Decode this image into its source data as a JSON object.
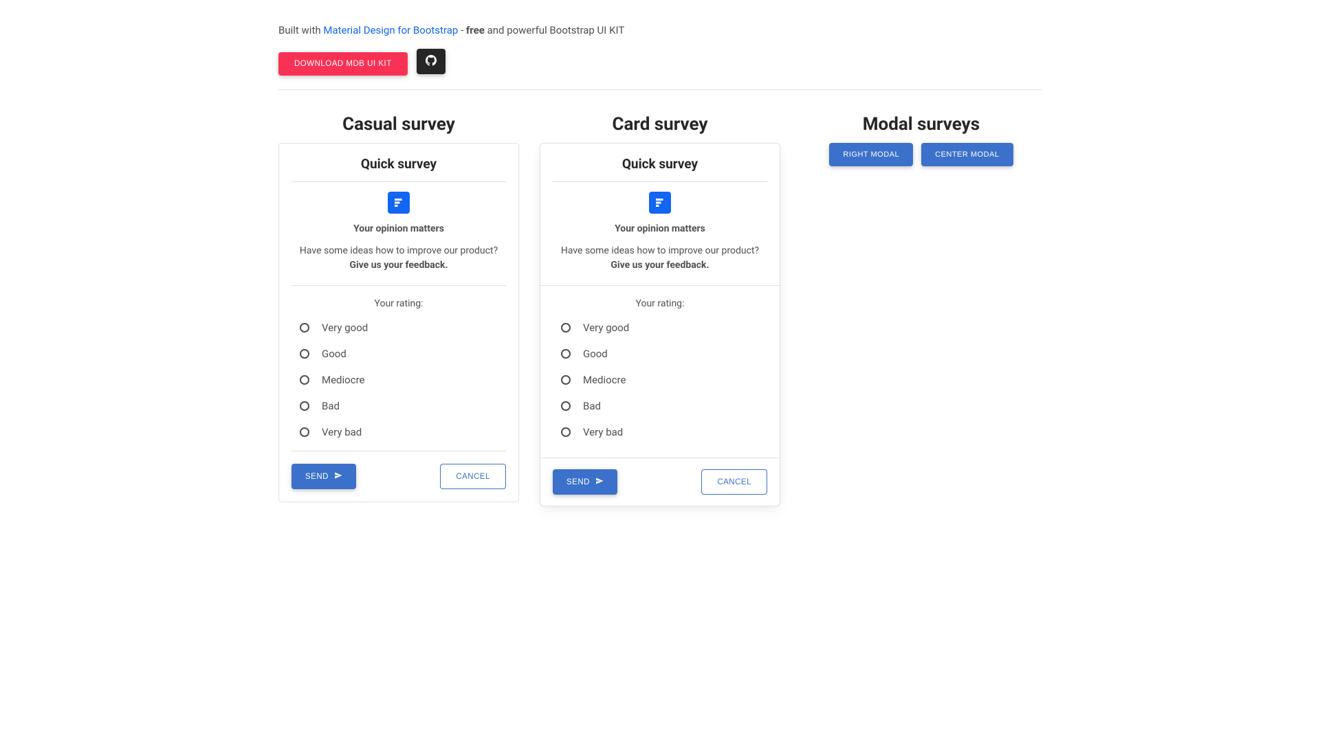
{
  "header": {
    "built_with": "Built with ",
    "mdb_link": "Material Design for Bootstrap",
    "dash": " - ",
    "free": "free",
    "powerful": " and powerful Bootstrap UI KIT",
    "download_button": "Download MDB UI KIT"
  },
  "sections": {
    "casual": {
      "title": "Casual survey",
      "survey_title": "Quick survey",
      "opinion": "Your opinion matters",
      "description_prefix": "Have some ideas how to improve our product? ",
      "description_bold": "Give us your feedback.",
      "rating_label": "Your rating:",
      "options": [
        "Very good",
        "Good",
        "Mediocre",
        "Bad",
        "Very bad"
      ],
      "send": "Send",
      "cancel": "Cancel"
    },
    "card": {
      "title": "Card survey",
      "survey_title": "Quick survey",
      "opinion": "Your opinion matters",
      "description_prefix": "Have some ideas how to improve our product? ",
      "description_bold": "Give us your feedback.",
      "rating_label": "Your rating:",
      "options": [
        "Very good",
        "Good",
        "Mediocre",
        "Bad",
        "Very bad"
      ],
      "send": "Send",
      "cancel": "Cancel"
    },
    "modal": {
      "title": "Modal surveys",
      "right_btn": "Right Modal",
      "center_btn": "Center Modal"
    }
  }
}
